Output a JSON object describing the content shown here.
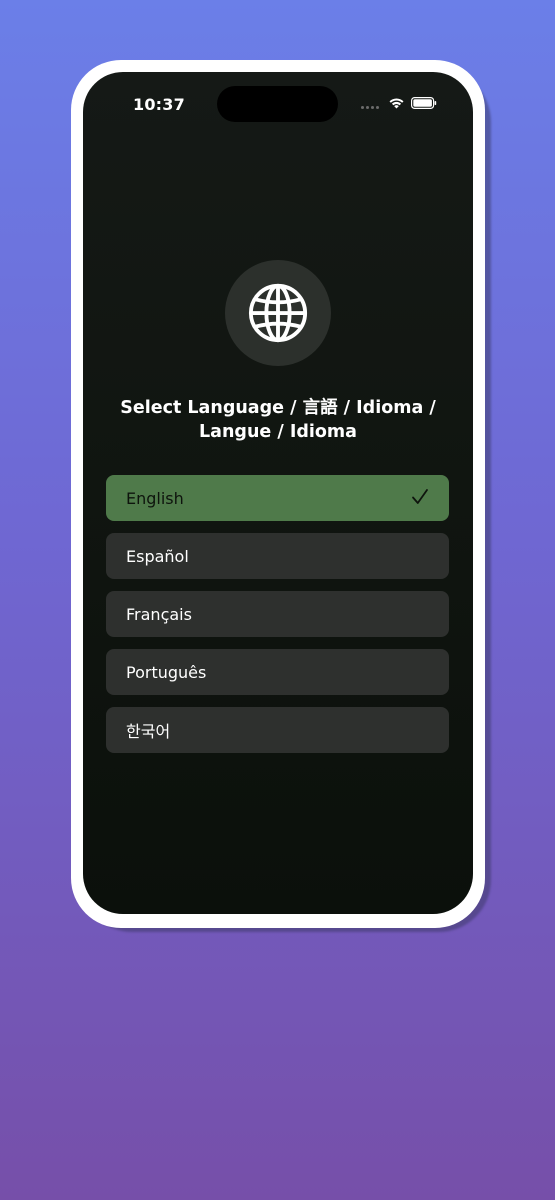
{
  "status_bar": {
    "time": "10:37"
  },
  "header": {
    "title": "Select Language / 言語 / Idioma / Langue / Idioma"
  },
  "languages": [
    {
      "label": "English",
      "selected": true
    },
    {
      "label": "Español",
      "selected": false
    },
    {
      "label": "Français",
      "selected": false
    },
    {
      "label": "Português",
      "selected": false
    },
    {
      "label": "한국어",
      "selected": false
    }
  ],
  "icons": {
    "globe": "globe-icon",
    "check": "checkmark-icon",
    "wifi": "wifi-icon",
    "battery": "battery-icon",
    "signal": "cellular-signal-icon"
  },
  "colors": {
    "background_top": "#6b7fe8",
    "background_bottom": "#764fa9",
    "screen_bg": "#111611",
    "row_bg": "#2e302e",
    "selected_bg": "#4f7a4a",
    "globe_circle": "#2c302c"
  }
}
